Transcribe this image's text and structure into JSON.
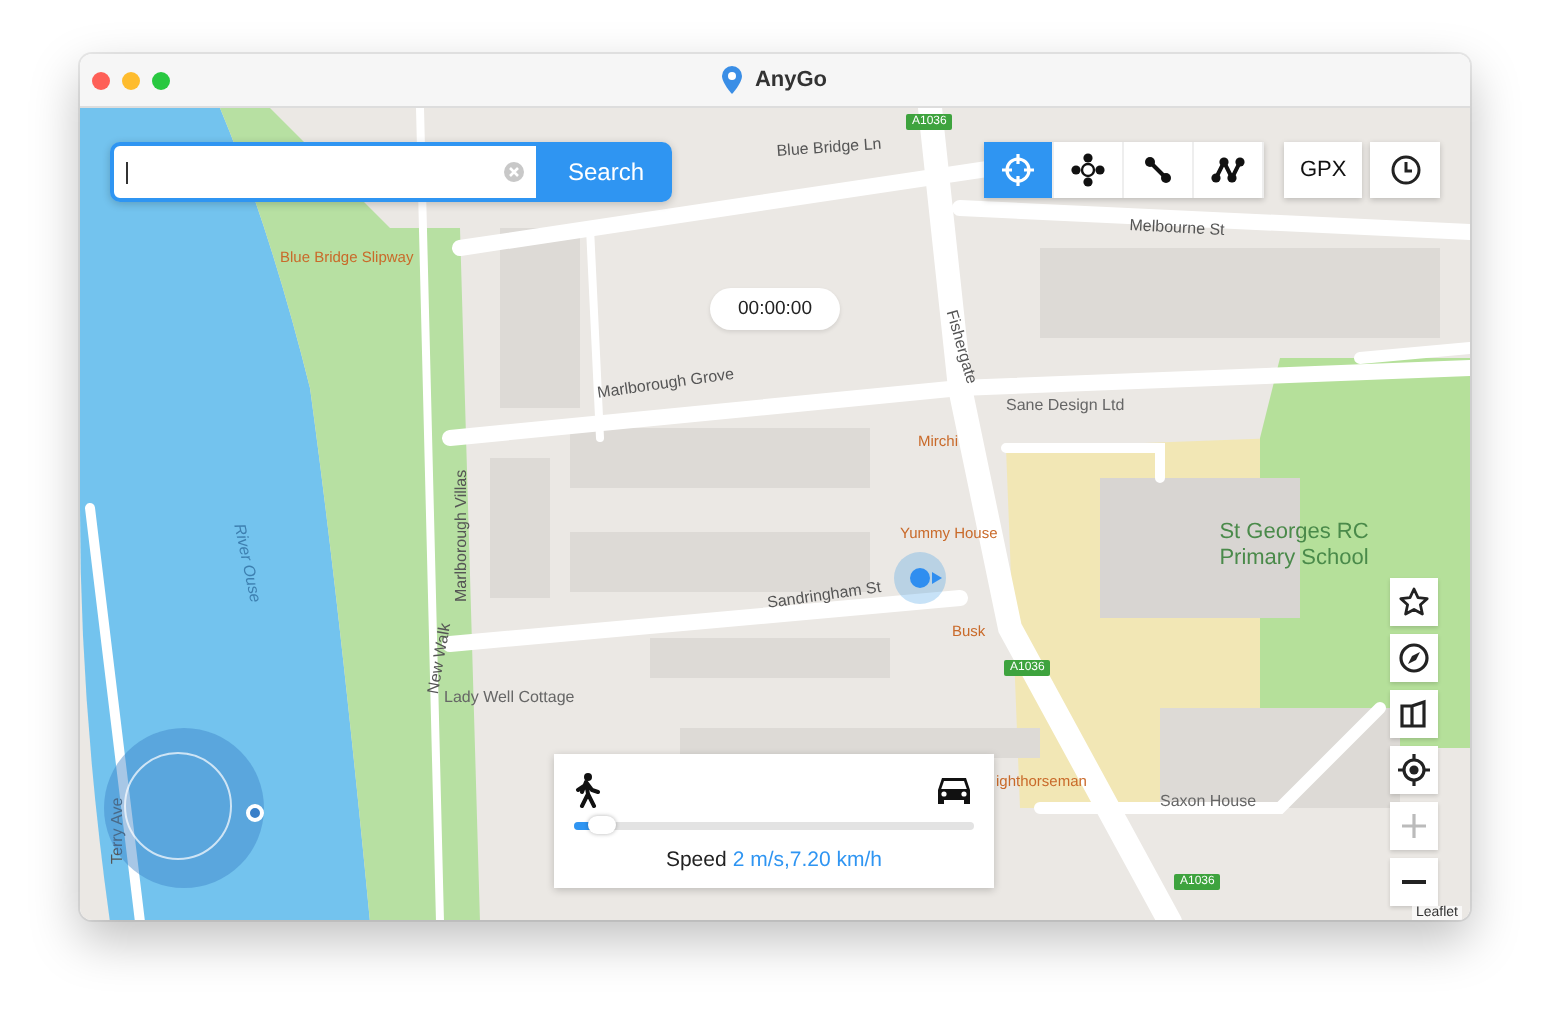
{
  "window": {
    "title": "AnyGo"
  },
  "search": {
    "button": "Search"
  },
  "modes": [
    {
      "kind": "teleport",
      "selected": true
    },
    {
      "kind": "jump",
      "selected": false
    },
    {
      "kind": "two-spot",
      "selected": false
    },
    {
      "kind": "multi-spot",
      "selected": false
    }
  ],
  "gpx_button": "GPX",
  "timer": "00:00:00",
  "map_labels": [
    {
      "kind": "street",
      "text": "Blue Bridge Ln"
    },
    {
      "kind": "street",
      "text": "Melbourne St"
    },
    {
      "kind": "poi",
      "text": "Blue Bridge Slipway"
    },
    {
      "kind": "street",
      "text": "Marlborough Grove"
    },
    {
      "kind": "street",
      "text": "Fishergate"
    },
    {
      "kind": "place",
      "text": "Sane Design Ltd"
    },
    {
      "kind": "poi",
      "text": "Mirchi"
    },
    {
      "kind": "poi",
      "text": "Yummy House"
    },
    {
      "kind": "park",
      "text": "St Georges RC Primary School"
    },
    {
      "kind": "street",
      "text": "Sandringham St"
    },
    {
      "kind": "poi",
      "text": "Busk"
    },
    {
      "kind": "street",
      "text": "Marlborough Villas"
    },
    {
      "kind": "water",
      "text": "River Ouse"
    },
    {
      "kind": "street",
      "text": "New Walk"
    },
    {
      "kind": "place",
      "text": "Lady Well Cottage"
    },
    {
      "kind": "poi",
      "text": "ighthorseman"
    },
    {
      "kind": "place",
      "text": "Saxon House"
    },
    {
      "kind": "street",
      "text": "Terry Ave"
    },
    {
      "kind": "road",
      "text": "A1036"
    },
    {
      "kind": "road",
      "text": "A1036"
    },
    {
      "kind": "road",
      "text": "A1036"
    }
  ],
  "map_controls": [
    {
      "kind": "favorite"
    },
    {
      "kind": "compass"
    },
    {
      "kind": "layers"
    },
    {
      "kind": "locate"
    },
    {
      "kind": "zoom-in",
      "disabled": true
    },
    {
      "kind": "zoom-out",
      "disabled": false
    }
  ],
  "speed_panel": {
    "label": "Speed",
    "value": "2 m/s,7.20 km/h",
    "level": 0.05
  },
  "attribution": "Leaflet"
}
